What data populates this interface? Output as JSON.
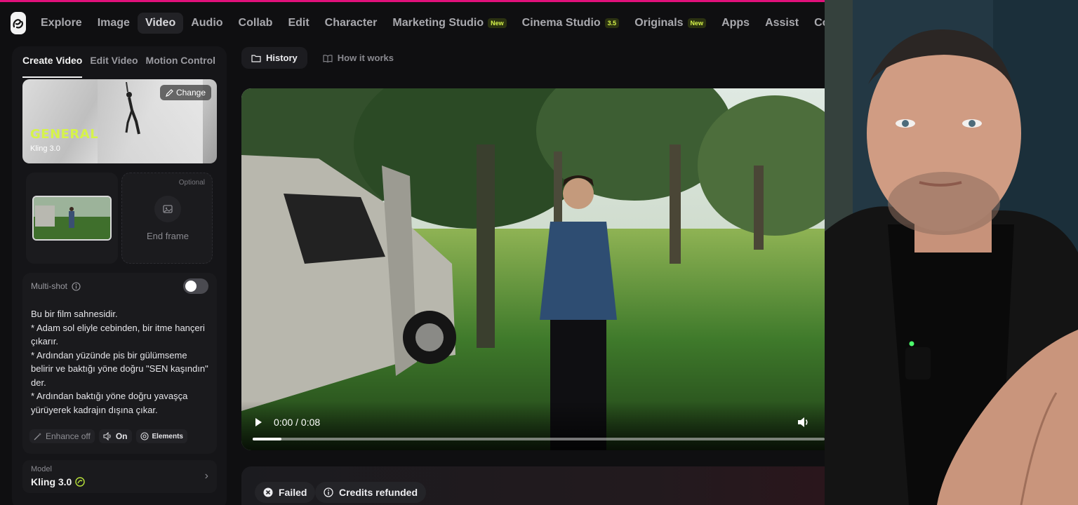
{
  "nav": {
    "items": [
      {
        "label": "Explore"
      },
      {
        "label": "Image"
      },
      {
        "label": "Video",
        "active": true
      },
      {
        "label": "Audio"
      },
      {
        "label": "Collab"
      },
      {
        "label": "Edit"
      },
      {
        "label": "Character"
      },
      {
        "label": "Marketing Studio",
        "badge": "New"
      },
      {
        "label": "Cinema Studio",
        "badge": "3.5"
      },
      {
        "label": "Originals",
        "badge": "New"
      },
      {
        "label": "Apps"
      },
      {
        "label": "Assist"
      },
      {
        "label": "Commu"
      }
    ]
  },
  "sidebar": {
    "tabs": [
      "Create Video",
      "Edit Video",
      "Motion Control"
    ],
    "model_card": {
      "title": "GENERAL",
      "subtitle": "Kling 3.0",
      "change_label": "Change"
    },
    "frames": {
      "optional_label": "Optional",
      "end_label": "End frame"
    },
    "prompt": {
      "multishot_label": "Multi-shot",
      "text": "Bu bir film sahnesidir.\n* Adam sol eliyle cebinden, bir itme hançeri çıkarır.\n* Ardından yüzünde pis bir gülümseme belirir ve baktığı yöne doğru \"SEN kaşındın\" der.\n* Ardından baktığı yöne doğru yavaşça yürüyerek kadrajın dışına çıkar.",
      "enhance_label": "Enhance off",
      "audio_label": "On",
      "elements_label": "Elements"
    },
    "model": {
      "label": "Model",
      "value": "Kling 3.0"
    }
  },
  "main": {
    "tabs": [
      {
        "label": "History",
        "active": true
      },
      {
        "label": "How it works"
      }
    ],
    "video": {
      "time": "0:00 / 0:08",
      "progress": 0.05
    },
    "status": {
      "failed_label": "Failed",
      "refund_label": "Credits refunded"
    }
  },
  "colors": {
    "accent": "#e0107a",
    "brand_lime": "#d6f34a"
  }
}
